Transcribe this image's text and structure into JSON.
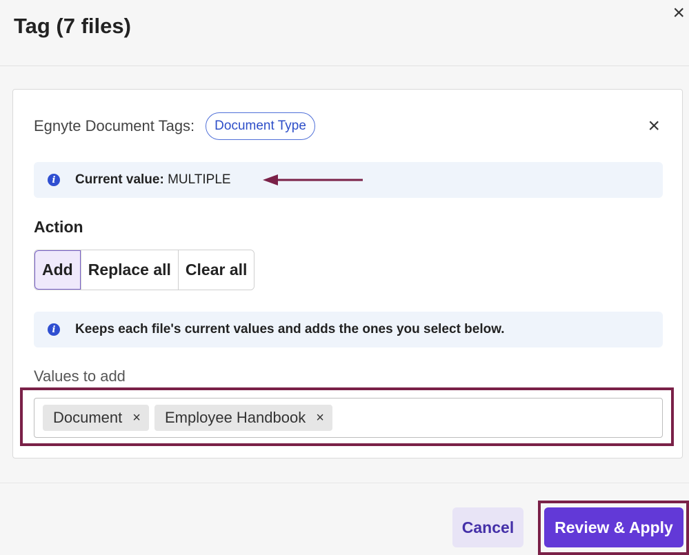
{
  "dialog": {
    "title": "Tag (7 files)",
    "close_icon": "close-icon"
  },
  "field": {
    "label": "Egnyte Document Tags:",
    "chip": "Document Type",
    "remove_icon": "close-icon"
  },
  "current_value": {
    "label": "Current value:",
    "value": "MULTIPLE",
    "icon": "info-icon",
    "annotation_icon": "arrow-left-icon"
  },
  "action": {
    "label": "Action",
    "options": [
      "Add",
      "Replace all",
      "Clear all"
    ],
    "selected": "Add"
  },
  "help": {
    "icon": "info-icon",
    "text": "Keeps each file's current values and adds the ones you select below."
  },
  "values": {
    "label": "Values to add",
    "tags": [
      "Document",
      "Employee Handbook"
    ],
    "remove_glyph": "×"
  },
  "footer": {
    "cancel": "Cancel",
    "apply": "Review & Apply"
  },
  "colors": {
    "accent": "#6239d7",
    "chip_border": "#4f6fd8",
    "annotation": "#7a2148",
    "info_bg": "#eff4fb"
  }
}
